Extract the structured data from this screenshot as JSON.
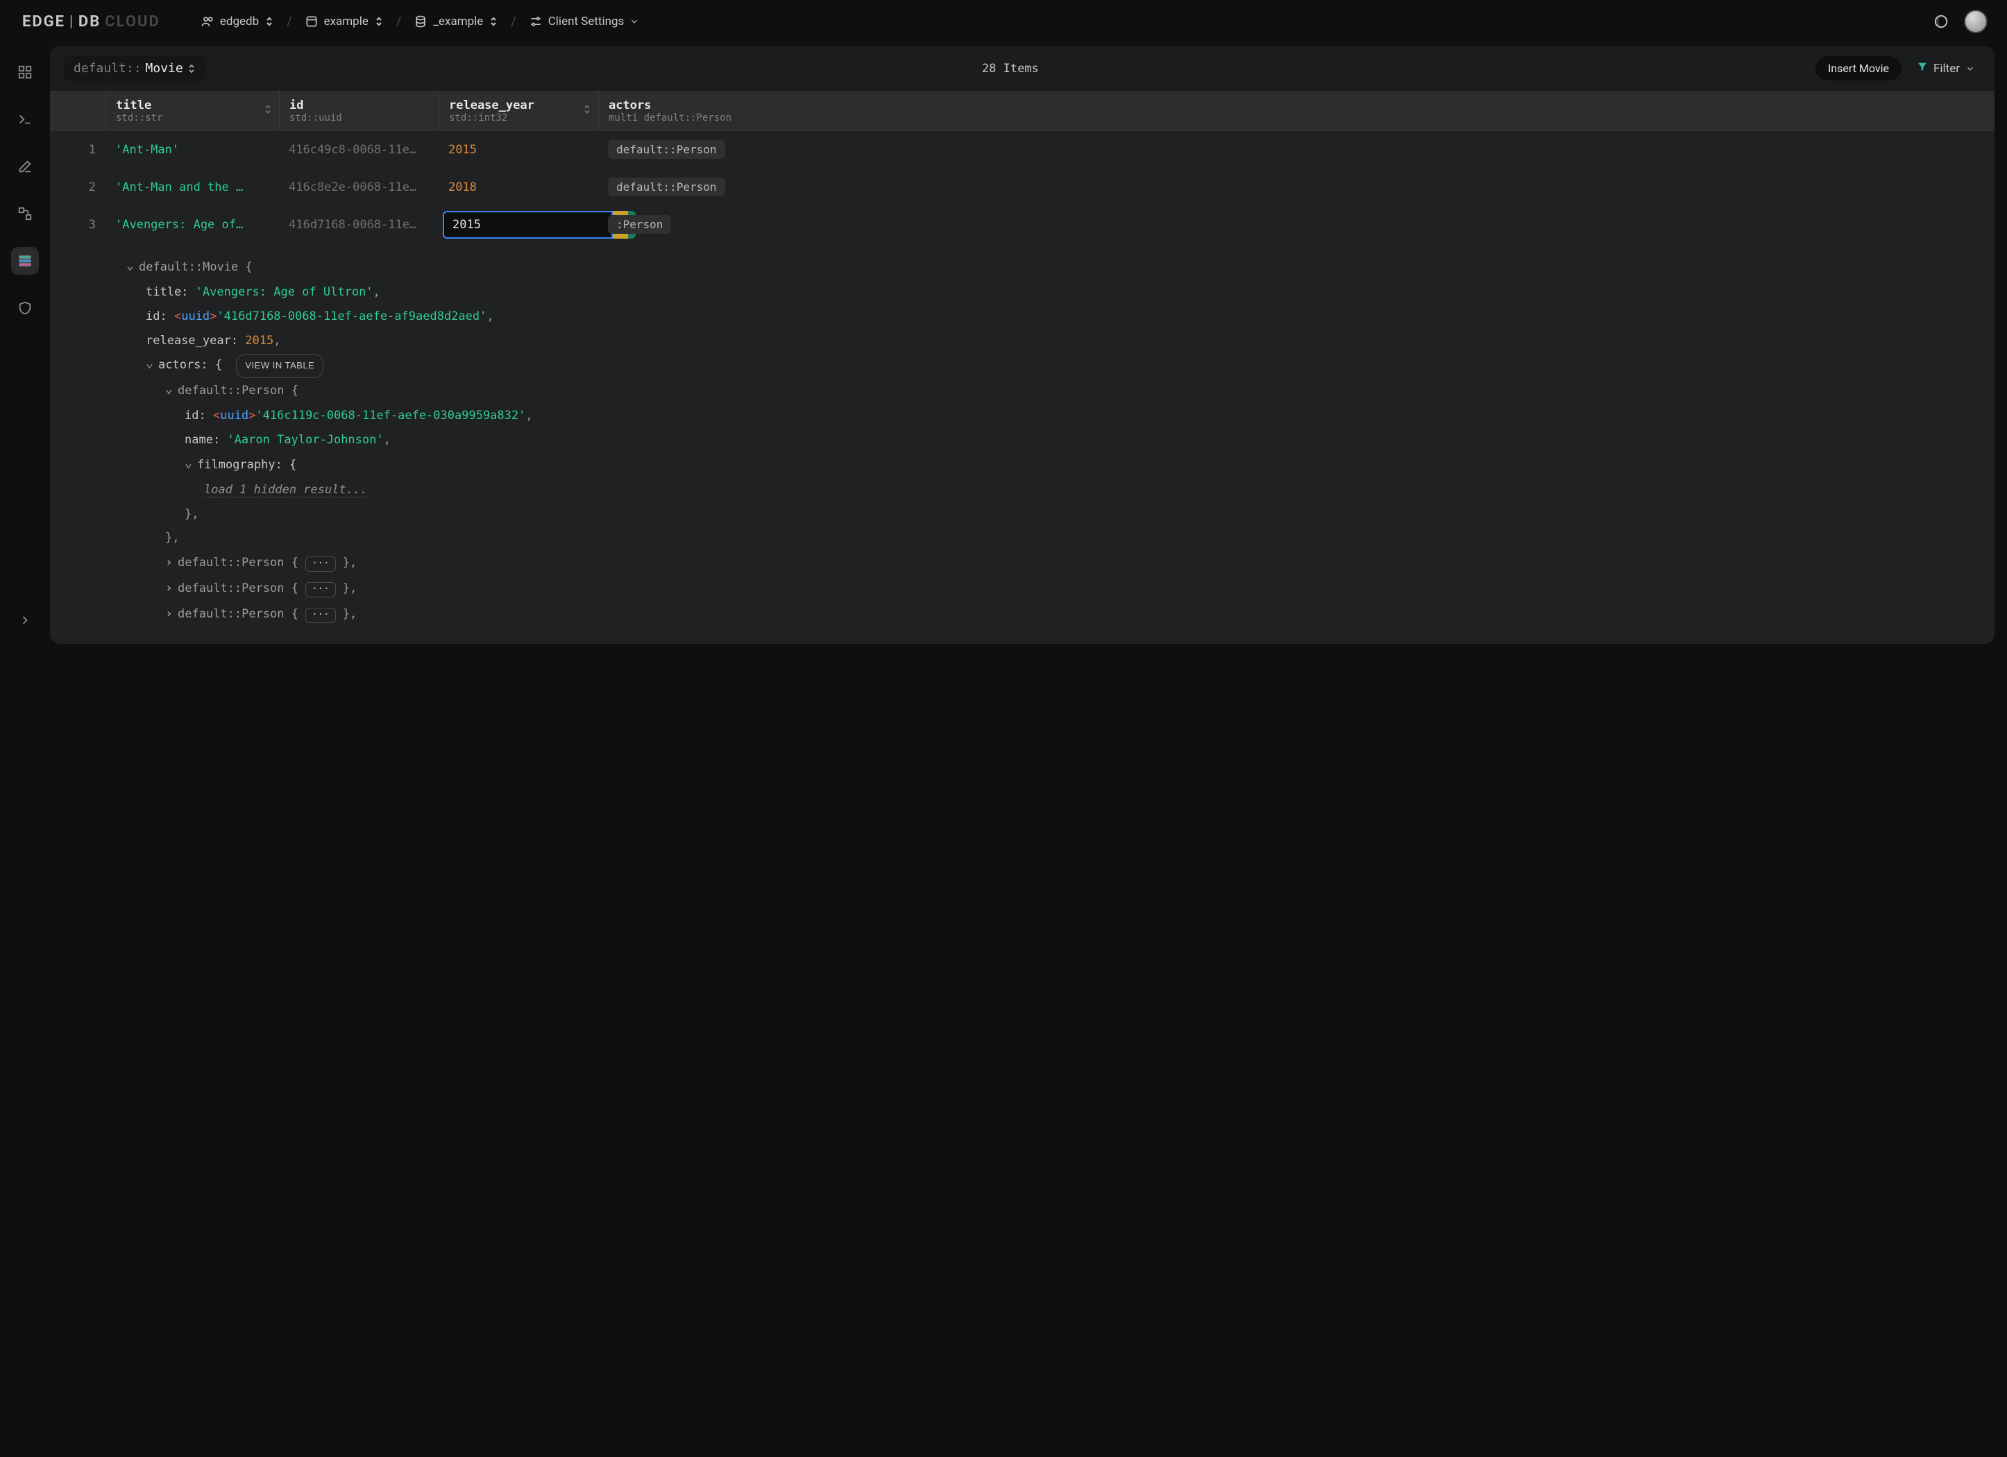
{
  "brand": {
    "edge": "EDGE",
    "bar": "|",
    "db": "DB",
    "cloud": "CLOUD"
  },
  "breadcrumbs": {
    "org": {
      "label": "edgedb"
    },
    "project": {
      "label": "example"
    },
    "database": {
      "label": "_example"
    },
    "settings": {
      "label": "Client Settings"
    }
  },
  "type_selector": {
    "namespace": "default::",
    "name": "Movie"
  },
  "item_count_label": "28 Items",
  "insert_label": "Insert Movie",
  "filter_label": "Filter",
  "columns": {
    "title": {
      "name": "title",
      "type": "std::str"
    },
    "id": {
      "name": "id",
      "type": "std::uuid"
    },
    "release_year": {
      "name": "release_year",
      "type": "std::int32"
    },
    "actors": {
      "name": "actors",
      "type": "multi default::Person"
    }
  },
  "rows": [
    {
      "n": "1",
      "title": "'Ant-Man'",
      "id": "416c49c8-0068-11e…",
      "release_year": "2015",
      "actors_chip": "default::Person"
    },
    {
      "n": "2",
      "title": "'Ant-Man and the …",
      "id": "416c8e2e-0068-11e…",
      "release_year": "2018",
      "actors_chip": "default::Person"
    },
    {
      "n": "3",
      "title": "'Avengers: Age of…",
      "id": "416d7168-0068-11e…",
      "release_year_edit": "2015",
      "actors_chip": ":Person"
    }
  ],
  "detail": {
    "header": "default::Movie {",
    "title_key": "title:",
    "title_val": "'Avengers: Age of Ultron'",
    "id_key": "id:",
    "cast_open": "<",
    "cast_type": "uuid",
    "cast_close": ">",
    "id_val": "'416d7168-0068-11ef-aefe-af9aed8d2aed'",
    "ry_key": "release_year:",
    "ry_val": "2015",
    "actors_key": "actors: {",
    "view_in_table": "VIEW IN TABLE",
    "person_header": "default::Person {",
    "person_id_key": "id:",
    "person_id_val": "'416c119c-0068-11ef-aefe-030a9959a832'",
    "person_name_key": "name:",
    "person_name_val": "'Aaron Taylor-Johnson'",
    "filmography_key": "filmography: {",
    "hidden_label": "load 1 hidden result...",
    "close_brace_comma": "},",
    "collapsed_person": "default::Person {",
    "dots": "···",
    "collapsed_close": "},"
  }
}
